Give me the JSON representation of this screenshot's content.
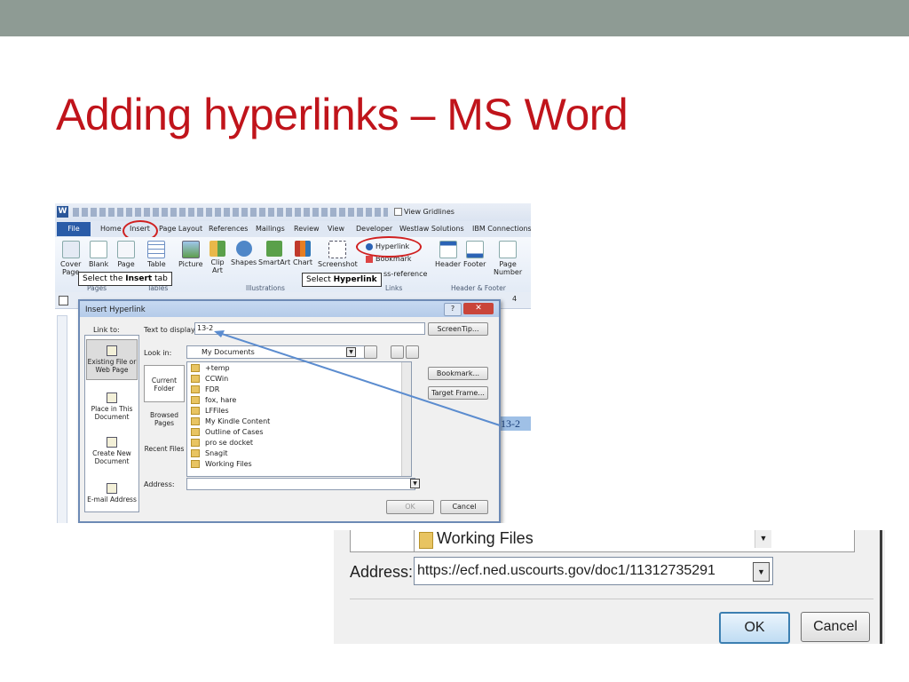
{
  "slide": {
    "title": "Adding hyperlinks – MS Word",
    "colors": {
      "topbar": "#8e9b94",
      "title": "#c0141b",
      "annotation": "#d02020",
      "arrow_red": "#a31d24",
      "arrow_blue": "#5b8ccf"
    }
  },
  "qat": {
    "view_gridlines": "View Gridlines"
  },
  "ribbon": {
    "tabs": [
      "File",
      "Home",
      "Insert",
      "Page Layout",
      "References",
      "Mailings",
      "Review",
      "View",
      "Developer",
      "Westlaw Solutions",
      "IBM Connections"
    ],
    "buttons": {
      "cover": "Cover",
      "page": "Page",
      "blank": "Blank",
      "page2": "Page",
      "table": "Table",
      "picture": "Picture",
      "clip": "Clip",
      "art": "Art",
      "shapes": "Shapes",
      "smartart": "SmartArt",
      "chart": "Chart",
      "screenshot": "Screenshot",
      "hyperlink": "Hyperlink",
      "bookmark": "Bookmark",
      "crossref": "ss-reference",
      "header": "Header",
      "footer": "Footer",
      "pagenum": "Page",
      "number": "Number"
    },
    "groups": {
      "pages": "Pages",
      "tables": "Tables",
      "illustrations": "Illustrations",
      "links": "Links",
      "header_footer": "Header & Footer"
    }
  },
  "callouts": {
    "insert": {
      "pre": "Select the ",
      "bold": "Insert",
      "post": " tab"
    },
    "hyperlink": {
      "pre": "Select ",
      "bold": "Hyperlink"
    }
  },
  "ruler": {
    "mark": "4"
  },
  "dialog": {
    "title": "Insert Hyperlink",
    "link_to_label": "Link to:",
    "text_to_display_label": "Text to display:",
    "text_to_display_value": "13-2",
    "screentip_label": "ScreenTip...",
    "look_in_label": "Look in:",
    "look_in_value": "My Documents",
    "link_to_items": [
      "Existing File or Web Page",
      "Place in This Document",
      "Create New Document",
      "E-mail Address"
    ],
    "side_items": [
      "Current Folder",
      "Browsed Pages",
      "Recent Files"
    ],
    "files": [
      "+temp",
      "CCWin",
      "FDR",
      "fox, hare",
      "LFFiles",
      "My Kindle Content",
      "Outline of Cases",
      "pro se docket",
      "Snagit",
      "Working Files"
    ],
    "bookmark_label": "Bookmark...",
    "target_frame_label": "Target Frame...",
    "address_label": "Address:",
    "address_value": "",
    "ok_label": "OK",
    "cancel_label": "Cancel"
  },
  "doc_selection": "13-2",
  "zoom_panel": {
    "file_item": "Working Files",
    "address_label": "Address:",
    "address_value": "https://ecf.ned.uscourts.gov/doc1/11312735291",
    "ok_label": "OK",
    "cancel_label": "Cancel"
  }
}
